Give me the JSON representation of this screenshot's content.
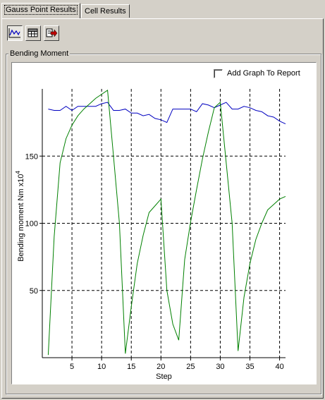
{
  "tabs": [
    {
      "label": "Gauss Point Results",
      "active": true
    },
    {
      "label": "Cell Results",
      "active": false
    }
  ],
  "toolbar": {
    "buttons": [
      {
        "icon": "line-graph-icon",
        "pressed": true
      },
      {
        "icon": "table-grid-icon",
        "pressed": false
      },
      {
        "icon": "export-arrow-icon",
        "pressed": false
      }
    ]
  },
  "group": {
    "title": "Bending Moment"
  },
  "report": {
    "label": "Add Graph To Report",
    "checked": false
  },
  "chart_data": {
    "type": "line",
    "xlabel": "Step",
    "ylabel": "Bending moment Nm",
    "yunit_multiplier": "x10^4",
    "ylabel_multiplier_text": "x10",
    "ylabel_multiplier_exp": "4",
    "xlim": [
      0,
      41
    ],
    "ylim": [
      0,
      200
    ],
    "x_ticks": [
      5,
      10,
      15,
      20,
      25,
      30,
      35,
      40
    ],
    "y_ticks": [
      50,
      100,
      150
    ],
    "grid": true,
    "series": [
      {
        "color": "#0000c0",
        "x": [
          1,
          2,
          3,
          4,
          5,
          6,
          7,
          8,
          9,
          10,
          11,
          12,
          13,
          14,
          15,
          16,
          17,
          18,
          19,
          20,
          21,
          22,
          23,
          24,
          25,
          26,
          27,
          28,
          29,
          30,
          31,
          32,
          33,
          34,
          35,
          36,
          37,
          38,
          39,
          40,
          41
        ],
        "values": [
          185,
          184,
          184,
          187,
          184,
          187,
          187,
          187,
          187,
          189,
          190,
          184,
          184,
          185,
          182,
          182,
          180,
          181,
          178,
          177,
          175,
          185,
          185,
          185,
          185,
          183,
          189,
          188,
          186,
          188,
          190,
          185,
          185,
          187,
          186,
          184,
          183,
          180,
          179,
          176,
          174
        ]
      },
      {
        "color": "#008000",
        "x": [
          1,
          2,
          3,
          4,
          5,
          6,
          7,
          8,
          9,
          10,
          11,
          12,
          13,
          14,
          15,
          16,
          17,
          18,
          19,
          20,
          21,
          22,
          23,
          24,
          25,
          26,
          27,
          28,
          29,
          30,
          31,
          32,
          33,
          34,
          35,
          36,
          37,
          38,
          39,
          40,
          41
        ],
        "values": [
          2,
          90,
          145,
          163,
          173,
          180,
          185,
          189,
          193,
          196,
          199,
          150,
          100,
          3,
          38,
          70,
          91,
          108,
          113,
          118,
          50,
          25,
          13,
          73,
          101,
          125,
          148,
          168,
          186,
          190,
          145,
          100,
          5,
          45,
          70,
          88,
          100,
          110,
          114,
          118,
          120
        ]
      }
    ]
  }
}
